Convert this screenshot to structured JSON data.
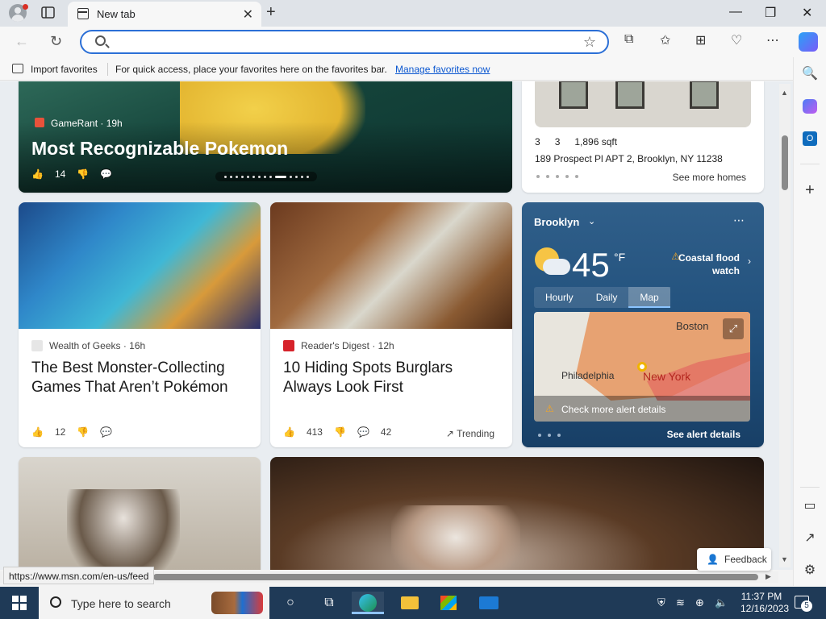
{
  "tab": {
    "title": "New tab"
  },
  "address": {
    "placeholder": "",
    "value": ""
  },
  "favorites": {
    "import_label": "Import favorites",
    "prompt": "For quick access, place your favorites here on the favorites bar.",
    "manage_link": "Manage favorites now"
  },
  "hero": {
    "source": "GameRant · 19h",
    "title": "Most Recognizable Pokemon",
    "likes": "14"
  },
  "home": {
    "beds": "3",
    "baths": "3",
    "sqft": "1,896 sqft",
    "address": "189 Prospect Pl APT 2, Brooklyn, NY 11238",
    "see_more": "See more homes"
  },
  "weather": {
    "city": "Brooklyn",
    "temp": "45",
    "unit": "°F",
    "alert_line1": "Coastal flood",
    "alert_line2": "watch",
    "tabs": [
      "Hourly",
      "Daily",
      "Map"
    ],
    "active_tab": "Map",
    "map_labels": {
      "boston": "Boston",
      "philadelphia": "Philadelphia",
      "new_york": "New York"
    },
    "check_alert": "Check more alert details",
    "see_alert": "See alert details"
  },
  "news": [
    {
      "source": "Wealth of Geeks · 16h",
      "title": "The Best Monster-Collecting Games That Aren’t Pokémon",
      "likes": "12",
      "comments": ""
    },
    {
      "source": "Reader's Digest · 12h",
      "title": "10 Hiding Spots Burglars Always Look First",
      "likes": "413",
      "comments": "42",
      "trending": "Trending"
    }
  ],
  "status": {
    "url": "https://www.msn.com/en-us/feed"
  },
  "feedback": {
    "label": "Feedback"
  },
  "taskbar": {
    "search_placeholder": "Type here to search",
    "time": "11:37 PM",
    "date": "12/16/2023",
    "notification_count": "5"
  }
}
